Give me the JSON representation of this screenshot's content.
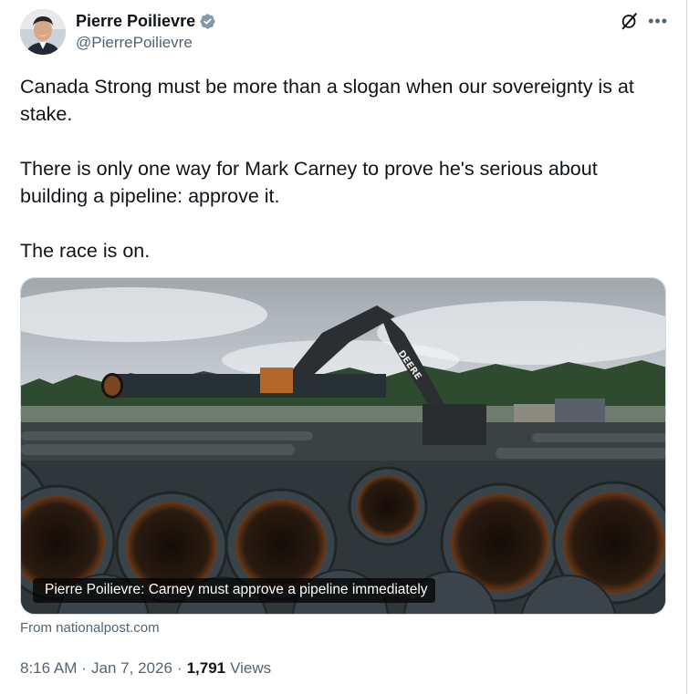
{
  "author": {
    "display_name": "Pierre Poilievre",
    "handle": "@PierrePoilievre",
    "verified": true
  },
  "icons": {
    "avatar": "avatar",
    "verified": "verified-badge-icon",
    "grok": "grok-icon",
    "more": "more-icon"
  },
  "tweet": {
    "paragraphs": [
      "Canada Strong must be more than a slogan when our sovereignty is at stake.",
      "There is only one way for Mark Carney to prove he's serious about building a pipeline: approve it.",
      "The race is on."
    ]
  },
  "card": {
    "caption": "Pierre Poilievre: Carney must approve a pipeline immediately",
    "image_text": "DEERE",
    "source": "From nationalpost.com"
  },
  "meta": {
    "time": "8:16 AM",
    "separator": "·",
    "date": "Jan 7, 2026",
    "views_count": "1,791",
    "views_label": "Views"
  },
  "colors": {
    "text": "#0f1419",
    "secondary": "#536471",
    "verified_badge": "#829aab",
    "border": "#cfd9de"
  }
}
